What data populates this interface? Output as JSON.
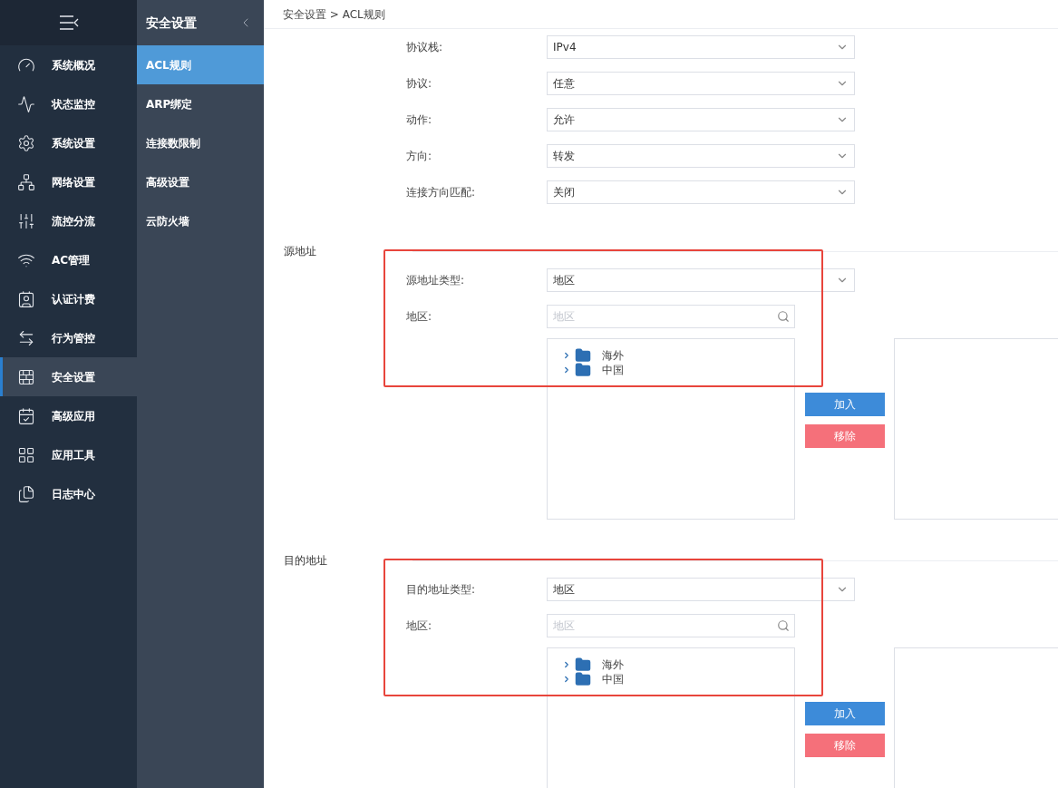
{
  "sidebar": {
    "items": [
      {
        "label": "系统概况",
        "kind": "gauge",
        "selected": false
      },
      {
        "label": "状态监控",
        "kind": "pulse",
        "selected": false
      },
      {
        "label": "系统设置",
        "kind": "gear",
        "selected": false
      },
      {
        "label": "网络设置",
        "kind": "network",
        "selected": false
      },
      {
        "label": "流控分流",
        "kind": "sliders",
        "selected": false
      },
      {
        "label": "AC管理",
        "kind": "wifi",
        "selected": false
      },
      {
        "label": "认证计费",
        "kind": "idcard",
        "selected": false
      },
      {
        "label": "行为管控",
        "kind": "arrows",
        "selected": false
      },
      {
        "label": "安全设置",
        "kind": "wall",
        "selected": true
      },
      {
        "label": "高级应用",
        "kind": "calendar",
        "selected": false
      },
      {
        "label": "应用工具",
        "kind": "apps",
        "selected": false
      },
      {
        "label": "日志中心",
        "kind": "files",
        "selected": false
      }
    ]
  },
  "submenu": {
    "title": "安全设置",
    "items": [
      {
        "label": "ACL规则",
        "selected": true
      },
      {
        "label": "ARP绑定",
        "selected": false
      },
      {
        "label": "连接数限制",
        "selected": false
      },
      {
        "label": "高级设置",
        "selected": false
      },
      {
        "label": "云防火墙",
        "selected": false
      }
    ]
  },
  "breadcrumb": "安全设置 > ACL规则",
  "form": [
    {
      "label": "协议栈:",
      "value": "IPv4"
    },
    {
      "label": "协议:",
      "value": "任意"
    },
    {
      "label": "动作:",
      "value": "允许"
    },
    {
      "label": "方向:",
      "value": "转发"
    },
    {
      "label": "连接方向匹配:",
      "value": "关闭"
    }
  ],
  "sections": [
    {
      "title": "源地址",
      "highlighted": true,
      "type_label": "源地址类型:",
      "type_value": "地区",
      "region_label": "地区:",
      "region_placeholder": "地区",
      "tree": [
        {
          "label": "海外",
          "expanded": false
        },
        {
          "label": "中国",
          "expanded": false
        }
      ],
      "buttons": [
        {
          "label": "加入",
          "kind": "add"
        },
        {
          "label": "移除",
          "kind": "remove"
        }
      ]
    },
    {
      "title": "目的地址",
      "highlighted": true,
      "type_label": "目的地址类型:",
      "type_value": "地区",
      "region_label": "地区:",
      "region_placeholder": "地区",
      "tree": [
        {
          "label": "海外",
          "expanded": false
        },
        {
          "label": "中国",
          "expanded": false
        }
      ],
      "buttons": [
        {
          "label": "加入",
          "kind": "add"
        },
        {
          "label": "移除",
          "kind": "remove"
        }
      ]
    }
  ]
}
